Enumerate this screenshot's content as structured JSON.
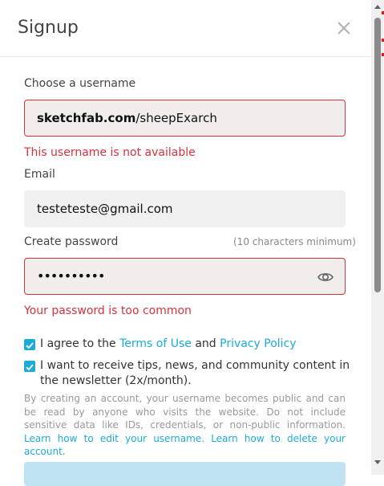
{
  "modal": {
    "title": "Signup",
    "close_icon": "close-icon"
  },
  "username": {
    "label": "Choose a username",
    "domain": "sketchfab.com",
    "value": "/sheepExarch",
    "error": "This username is not available"
  },
  "email": {
    "label": "Email",
    "value": "testeteste@gmail.com"
  },
  "password": {
    "label": "Create password",
    "hint": "(10 characters minimum)",
    "value": "••••••••••",
    "toggle_icon": "eye-icon",
    "error": "Your password is too common"
  },
  "agreements": {
    "terms_prefix": "I agree to the ",
    "terms_link": "Terms of Use",
    "and": " and ",
    "privacy_link": "Privacy Policy",
    "terms_checked": true,
    "newsletter": "I want to receive tips, news, and community content in the newsletter (2x/month).",
    "newsletter_checked": true
  },
  "legal": {
    "text": "By creating an account, your username becomes public and can be read by anyone who visits the website. Do not include sensitive data like IDs, credentials, or non-public information. ",
    "edit_link": "Learn how to edit your username.",
    "delete_link": "Learn how to delete your account."
  },
  "colors": {
    "accent": "#1caad9",
    "error": "#d4333d",
    "submit_disabled": "#bfe3f3"
  }
}
